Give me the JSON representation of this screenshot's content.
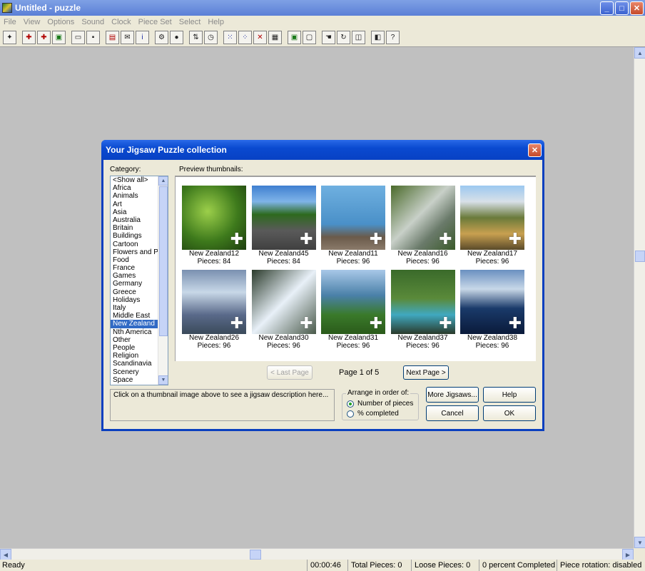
{
  "window": {
    "title": "Untitled - puzzle"
  },
  "menu": [
    "File",
    "View",
    "Options",
    "Sound",
    "Clock",
    "Piece Set",
    "Select",
    "Help"
  ],
  "dialog": {
    "title": "Your Jigsaw Puzzle collection",
    "category_label": "Category:",
    "preview_label": "Preview thumbnails:",
    "categories": [
      "<Show all>",
      "Africa",
      "Animals",
      "Art",
      "Asia",
      "Australia",
      "Britain",
      "Buildings",
      "Cartoon",
      "Flowers and Pla",
      "Food",
      "France",
      "Games",
      "Germany",
      "Greece",
      "Holidays",
      "Italy",
      "Middle East",
      "New Zealand",
      "Nth America",
      "Other",
      "People",
      "Religion",
      "Scandinavia",
      "Scenery",
      "Space"
    ],
    "selected_category": "New Zealand",
    "thumbnails": [
      {
        "name": "New Zealand12",
        "pieces": "Pieces: 84"
      },
      {
        "name": "New Zealand45",
        "pieces": "Pieces: 84"
      },
      {
        "name": "New Zealand11",
        "pieces": "Pieces: 96"
      },
      {
        "name": "New Zealand16",
        "pieces": "Pieces: 96"
      },
      {
        "name": "New Zealand17",
        "pieces": "Pieces: 96"
      },
      {
        "name": "New Zealand26",
        "pieces": "Pieces: 96"
      },
      {
        "name": "New Zealand30",
        "pieces": "Pieces: 96"
      },
      {
        "name": "New Zealand31",
        "pieces": "Pieces: 96"
      },
      {
        "name": "New Zealand37",
        "pieces": "Pieces: 96"
      },
      {
        "name": "New Zealand38",
        "pieces": "Pieces: 96"
      }
    ],
    "last_page": "< Last Page",
    "page_indicator": "Page 1 of 5",
    "next_page": "Next Page >",
    "description": "Click on a thumbnail image above to see a jigsaw description here...",
    "arrange_label": "Arrange in order of:",
    "arrange_options": [
      "Number of pieces",
      "% completed"
    ],
    "more_jigsaws": "More Jigsaws...",
    "help": "Help",
    "cancel": "Cancel",
    "ok": "OK"
  },
  "status": {
    "ready": "Ready",
    "time": "00:00:46",
    "total": "Total Pieces: 0",
    "loose": "Loose Pieces: 0",
    "completed": "0 percent Completed",
    "rotation": "Piece rotation: disabled"
  }
}
